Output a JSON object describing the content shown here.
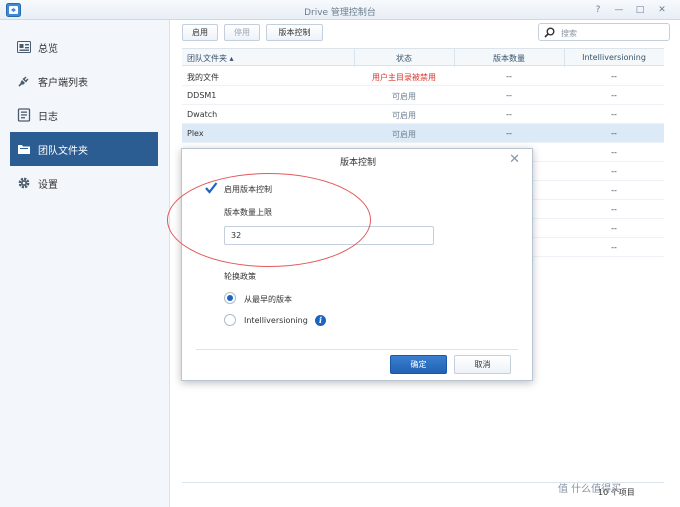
{
  "window": {
    "title": "Drive 管理控制台",
    "controls": [
      "?",
      "—",
      "□",
      "✕"
    ]
  },
  "sidebar": {
    "items": [
      {
        "label": "总览",
        "icon": "overview-icon"
      },
      {
        "label": "客户端列表",
        "icon": "plug-icon"
      },
      {
        "label": "日志",
        "icon": "log-icon"
      },
      {
        "label": "团队文件夹",
        "icon": "folder-icon",
        "active": true
      },
      {
        "label": "设置",
        "icon": "gear-icon"
      }
    ]
  },
  "toolbar": {
    "enable_label": "启用",
    "disable_label": "停用",
    "version_label": "版本控制",
    "search_placeholder": "搜索"
  },
  "grid": {
    "headers": [
      "团队文件夹 ▴",
      "状态",
      "版本数量",
      "Intelliversioning"
    ],
    "rows": [
      {
        "name": "我的文件",
        "status": "用户主目录被禁用",
        "versions": "--",
        "intelli": "--"
      },
      {
        "name": "DDSM1",
        "status": "可启用",
        "versions": "--",
        "intelli": "--"
      },
      {
        "name": "Dwatch",
        "status": "可启用",
        "versions": "--",
        "intelli": "--"
      },
      {
        "name": "Plex",
        "status": "可启用",
        "versions": "--",
        "intelli": "--"
      },
      {
        "name": "",
        "status": "",
        "versions": "--",
        "intelli": "--"
      },
      {
        "name": "",
        "status": "",
        "versions": "--",
        "intelli": "--"
      },
      {
        "name": "",
        "status": "",
        "versions": "--",
        "intelli": "--"
      },
      {
        "name": "",
        "status": "",
        "versions": "--",
        "intelli": "--"
      },
      {
        "name": "",
        "status": "",
        "versions": "--",
        "intelli": "--"
      },
      {
        "name": "",
        "status": "",
        "versions": "--",
        "intelli": "--"
      }
    ]
  },
  "pager": {
    "text": "10 个项目"
  },
  "dialog": {
    "title": "版本控制",
    "enable_checkbox_label": "启用版本控制",
    "enable_checked": true,
    "limit_label": "版本数量上限",
    "limit_value": "32",
    "policy_label": "轮换政策",
    "policy_option_oldest": "从最早的版本",
    "policy_option_intelli": "Intelliversioning",
    "confirm_label": "确定",
    "cancel_label": "取消"
  },
  "watermark": {
    "text": "值 什么值得买"
  },
  "colors": {
    "accent": "#2b5d92",
    "primary_button": "#2162b5",
    "warning_text": "#d9342b",
    "annotation": "#e2595b"
  }
}
